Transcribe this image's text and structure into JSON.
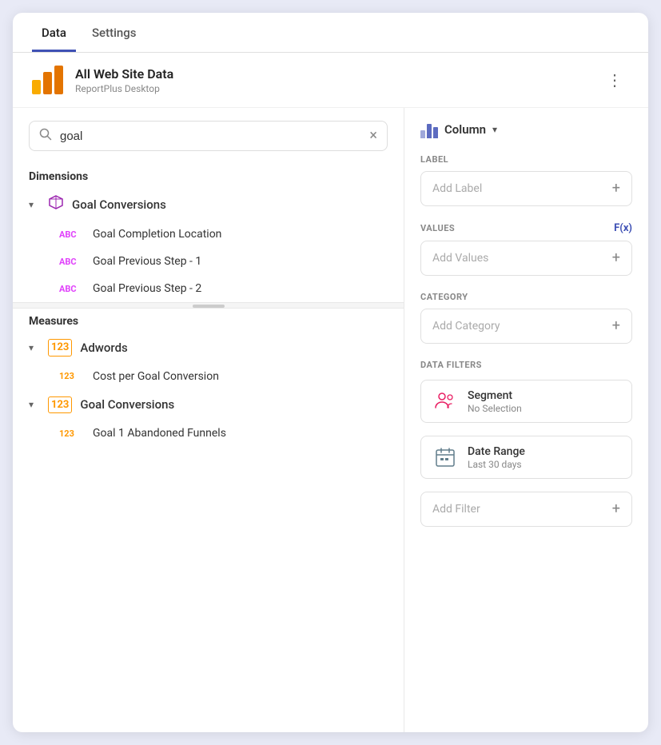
{
  "tabs": [
    {
      "id": "data",
      "label": "Data",
      "active": true
    },
    {
      "id": "settings",
      "label": "Settings",
      "active": false
    }
  ],
  "datasource": {
    "name": "All Web Site Data",
    "sub": "ReportPlus Desktop",
    "more_label": "⋮"
  },
  "search": {
    "placeholder": "goal",
    "value": "goal",
    "clear_label": "×"
  },
  "dimensions": {
    "label": "Dimensions",
    "groups": [
      {
        "id": "goal-conversions-dim",
        "icon": "cube",
        "label": "Goal Conversions",
        "expanded": true,
        "items": [
          {
            "type": "ABC",
            "label": "Goal Completion Location"
          },
          {
            "type": "ABC",
            "label": "Goal Previous Step - 1"
          },
          {
            "type": "ABC",
            "label": "Goal Previous Step - 2"
          }
        ]
      }
    ]
  },
  "measures": {
    "label": "Measures",
    "groups": [
      {
        "id": "adwords",
        "label": "Adwords",
        "expanded": true,
        "items": [
          {
            "type": "123",
            "label": "Cost per Goal Conversion"
          }
        ]
      },
      {
        "id": "goal-conversions-meas",
        "label": "Goal Conversions",
        "expanded": true,
        "items": [
          {
            "type": "123",
            "label": "Goal 1 Abandoned Funnels"
          }
        ]
      }
    ]
  },
  "right_panel": {
    "chart_type": {
      "label": "Column",
      "dropdown_arrow": "▾"
    },
    "label_section": {
      "heading": "LABEL",
      "add_label": "Add Label",
      "add_icon": "+"
    },
    "values_section": {
      "heading": "VALUES",
      "fx_label": "F(x)",
      "add_label": "Add Values",
      "add_icon": "+"
    },
    "category_section": {
      "heading": "CATEGORY",
      "add_label": "Add Category",
      "add_icon": "+"
    },
    "data_filters": {
      "heading": "DATA FILTERS",
      "filters": [
        {
          "id": "segment",
          "name": "Segment",
          "value": "No Selection"
        },
        {
          "id": "date-range",
          "name": "Date Range",
          "value": "Last 30 days"
        }
      ],
      "add_label": "Add Filter",
      "add_icon": "+"
    }
  }
}
